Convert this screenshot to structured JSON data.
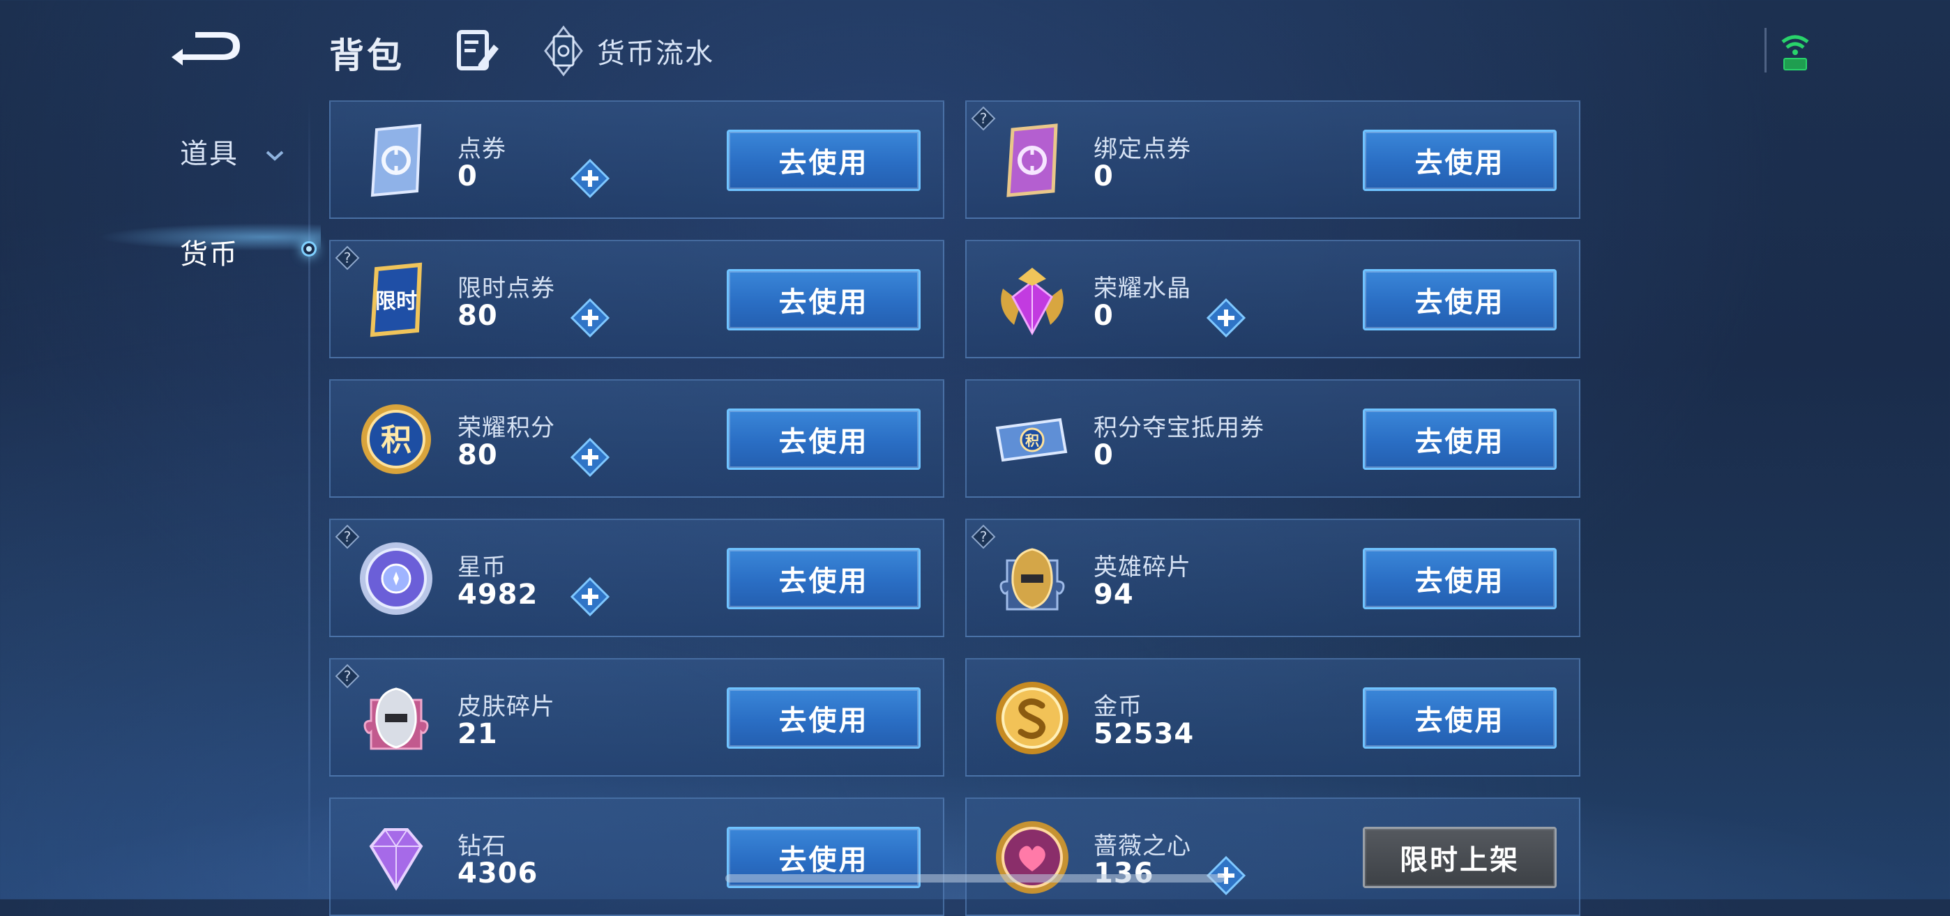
{
  "header": {
    "title": "背包",
    "flow_label": "货币流水"
  },
  "sidebar": {
    "items": [
      {
        "label": "道具"
      },
      {
        "label": "货币"
      }
    ]
  },
  "cards": [
    {
      "name": "点券",
      "value": "0",
      "button": "去使用"
    },
    {
      "name": "绑定点券",
      "value": "0",
      "button": "去使用"
    },
    {
      "name": "限时点券",
      "value": "80",
      "button": "去使用"
    },
    {
      "name": "荣耀水晶",
      "value": "0",
      "button": "去使用"
    },
    {
      "name": "荣耀积分",
      "value": "80",
      "button": "去使用"
    },
    {
      "name": "积分夺宝抵用券",
      "value": "0",
      "button": "去使用"
    },
    {
      "name": "星币",
      "value": "4982",
      "button": "去使用"
    },
    {
      "name": "英雄碎片",
      "value": "94",
      "button": "去使用"
    },
    {
      "name": "皮肤碎片",
      "value": "21",
      "button": "去使用"
    },
    {
      "name": "金币",
      "value": "52534",
      "button": "去使用"
    },
    {
      "name": "钻石",
      "value": "4306",
      "button": "去使用"
    },
    {
      "name": "蔷薇之心",
      "value": "136",
      "button": "限时上架"
    }
  ],
  "icon_text": {
    "limited": "限时",
    "points": "积",
    "ticket": "积"
  }
}
